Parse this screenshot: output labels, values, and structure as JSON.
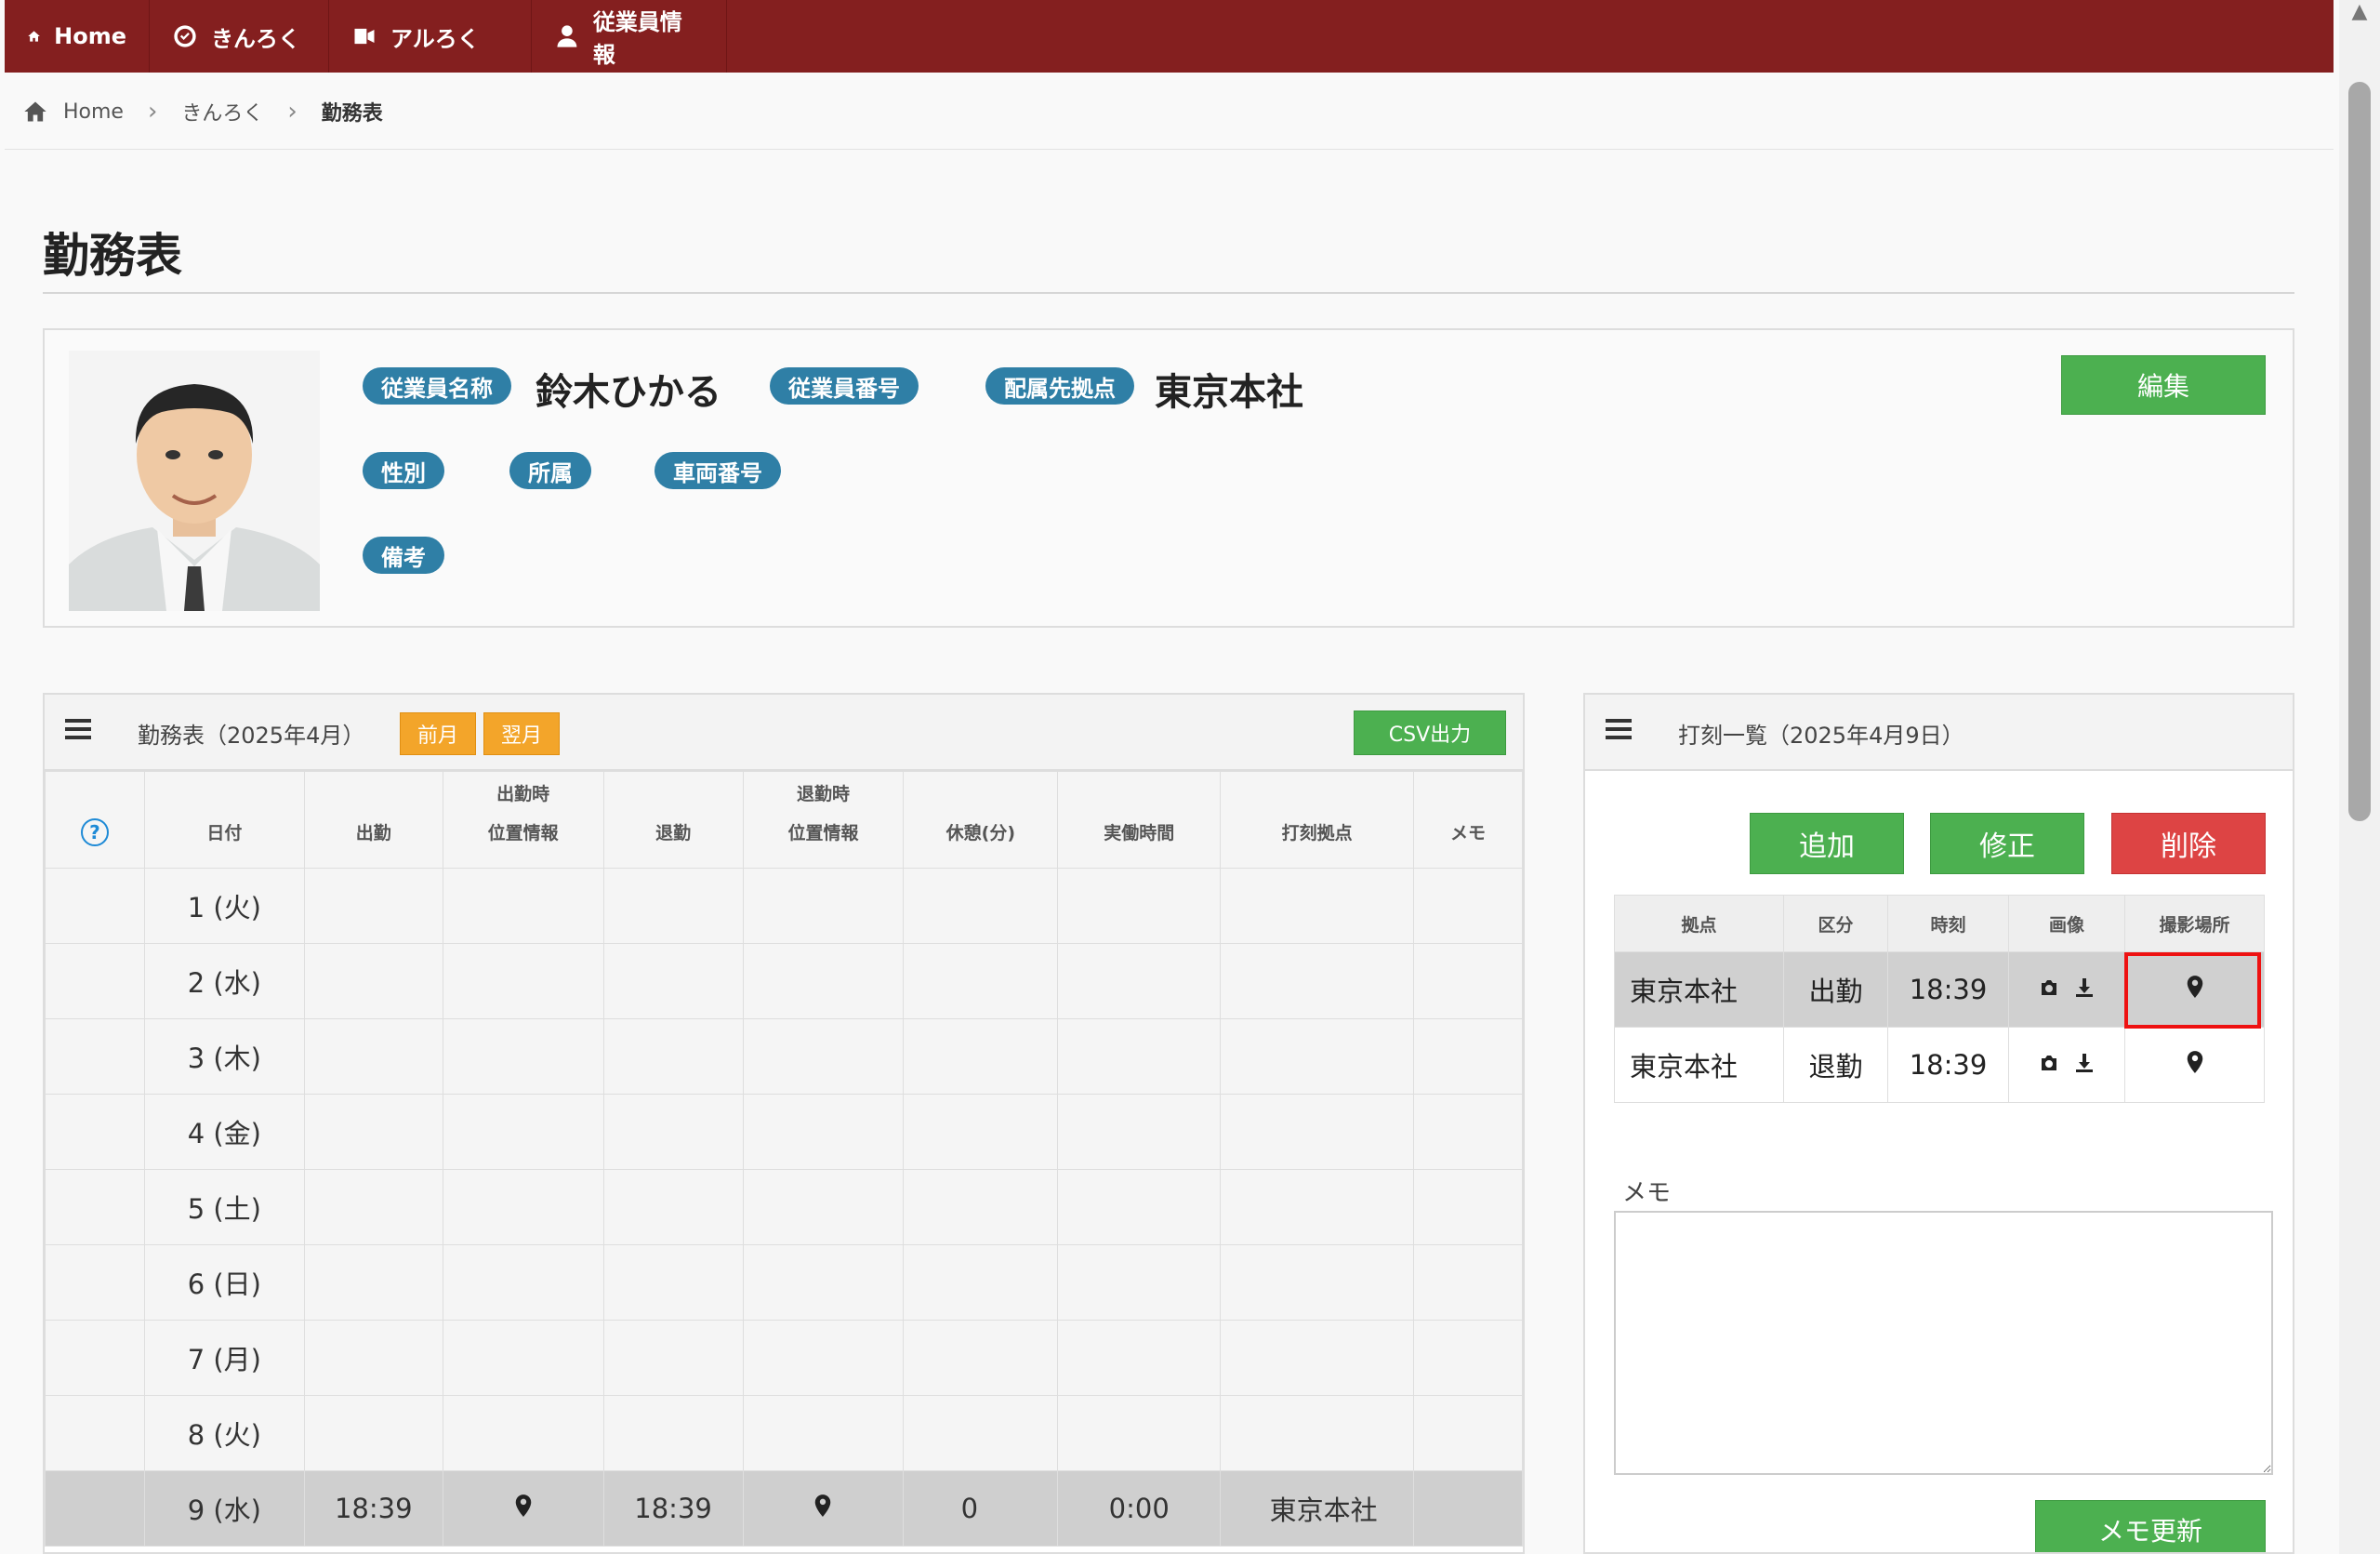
{
  "nav": {
    "home": "Home",
    "kinrok": "きんろく",
    "alrok": "アルろく",
    "employee": "従業員情報"
  },
  "breadcrumb": {
    "home": "Home",
    "section": "きんろく",
    "current": "勤務表"
  },
  "page_title": "勤務表",
  "profile": {
    "name_label": "従業員名称",
    "name": "鈴木ひかる",
    "number_label": "従業員番号",
    "number": "",
    "base_label": "配属先拠点",
    "base": "東京本社",
    "gender_label": "性別",
    "dept_label": "所属",
    "vehicle_label": "車両番号",
    "note_label": "備考",
    "edit_button": "編集"
  },
  "attendance": {
    "title": "勤務表（2025年4月）",
    "prev_button": "前月",
    "next_button": "翌月",
    "csv_button": "CSV出力",
    "help_icon": "?",
    "columns": {
      "date": "日付",
      "clock_in": "出勤",
      "in_location_1": "出勤時",
      "in_location_2": "位置情報",
      "clock_out": "退勤",
      "out_location_1": "退勤時",
      "out_location_2": "位置情報",
      "break": "休憩(分)",
      "actual": "実働時間",
      "base": "打刻拠点",
      "memo": "メモ"
    },
    "rows": [
      {
        "date": "1 (火)",
        "day_type": "weekday",
        "clock_in": "",
        "clock_out": "",
        "break": "",
        "actual": "",
        "base": ""
      },
      {
        "date": "2 (水)",
        "day_type": "weekday",
        "clock_in": "",
        "clock_out": "",
        "break": "",
        "actual": "",
        "base": ""
      },
      {
        "date": "3 (木)",
        "day_type": "weekday",
        "clock_in": "",
        "clock_out": "",
        "break": "",
        "actual": "",
        "base": ""
      },
      {
        "date": "4 (金)",
        "day_type": "weekday",
        "clock_in": "",
        "clock_out": "",
        "break": "",
        "actual": "",
        "base": ""
      },
      {
        "date": "5 (土)",
        "day_type": "saturday",
        "clock_in": "",
        "clock_out": "",
        "break": "",
        "actual": "",
        "base": ""
      },
      {
        "date": "6 (日)",
        "day_type": "sunday",
        "clock_in": "",
        "clock_out": "",
        "break": "",
        "actual": "",
        "base": ""
      },
      {
        "date": "7 (月)",
        "day_type": "weekday",
        "clock_in": "",
        "clock_out": "",
        "break": "",
        "actual": "",
        "base": ""
      },
      {
        "date": "8 (火)",
        "day_type": "weekday",
        "clock_in": "",
        "clock_out": "",
        "break": "",
        "actual": "",
        "base": ""
      },
      {
        "date": "9 (水)",
        "day_type": "weekday",
        "clock_in": "18:39",
        "clock_out": "18:39",
        "break": "0",
        "actual": "0:00",
        "base": "東京本社",
        "has_location": true,
        "selected": true
      }
    ],
    "colors": {
      "saturday": "#2e9be0",
      "sunday": "#e8702a"
    }
  },
  "punch": {
    "title": "打刻一覧（2025年4月9日）",
    "add_button": "追加",
    "edit_button": "修正",
    "delete_button": "削除",
    "columns": {
      "base": "拠点",
      "type": "区分",
      "time": "時刻",
      "image": "画像",
      "place": "撮影場所"
    },
    "rows": [
      {
        "base": "東京本社",
        "type": "出勤",
        "time": "18:39"
      },
      {
        "base": "東京本社",
        "type": "退勤",
        "time": "18:39"
      }
    ],
    "memo_label": "メモ",
    "memo_value": "",
    "memo_button": "メモ更新"
  },
  "colors": {
    "nav_bg": "#841f1f",
    "tag_bg": "#2f7fa6",
    "green": "#4cb050",
    "orange": "#f3a52a",
    "red": "#dd4444",
    "highlight": "#ee1111"
  }
}
